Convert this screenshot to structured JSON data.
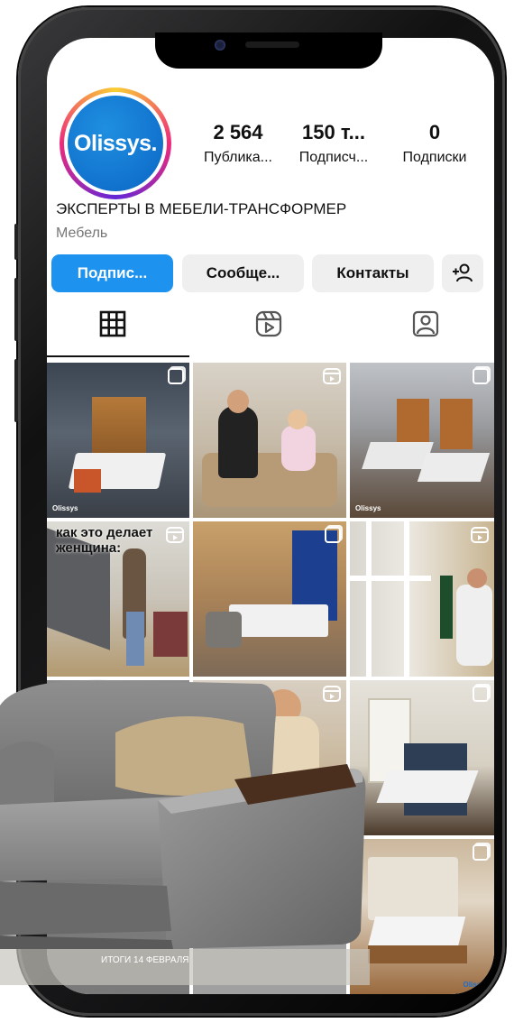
{
  "profile": {
    "avatar_text": "Olissys.",
    "stats": [
      {
        "value": "2 564",
        "label": "Публика..."
      },
      {
        "value": "150 т...",
        "label": "Подписч..."
      },
      {
        "value": "0",
        "label": "Подписки"
      }
    ],
    "name": "ЭКСПЕРТЫ В МЕБЕЛИ-ТРАНСФОРМЕР",
    "category": "Мебель"
  },
  "actions": {
    "follow": "Подпис...",
    "message": "Сообще...",
    "contacts": "Контакты",
    "add_person_icon": "add-person-icon"
  },
  "tabs": [
    {
      "icon": "grid-icon",
      "active": true
    },
    {
      "icon": "reels-icon",
      "active": false
    },
    {
      "icon": "tagged-icon",
      "active": false
    }
  ],
  "posts": {
    "p4_text": "как это делает женщина:",
    "p13_caption": "ИТОГИ 14 ФЕВРАЛЯ",
    "p15_logo": "Olissys",
    "brand_tag": "Olissys"
  },
  "colors": {
    "accent": "#1d92ee",
    "button_bg": "#efefef",
    "text": "#111111",
    "muted": "#777777"
  }
}
